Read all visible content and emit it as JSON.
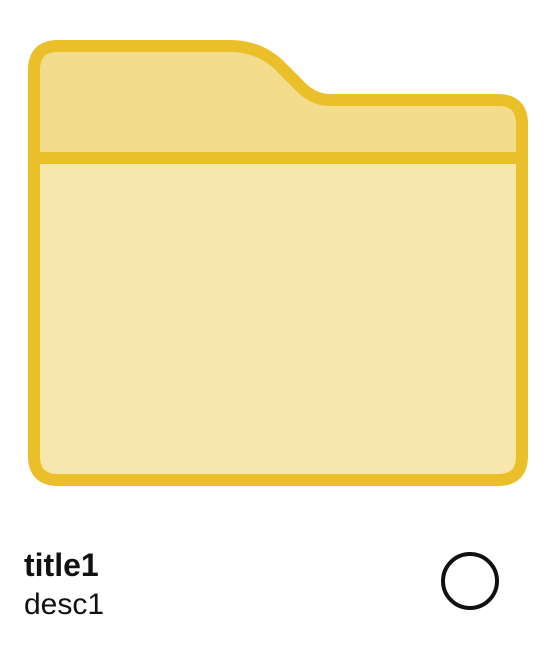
{
  "item": {
    "title": "title1",
    "description": "desc1",
    "icon": "folder-icon",
    "selection_icon": "radio-circle-icon",
    "selected": false
  },
  "colors": {
    "folder_outline": "#EBBF2A",
    "folder_tab_fill": "#F3DC8C",
    "folder_body_fill": "#F7E7AC"
  }
}
